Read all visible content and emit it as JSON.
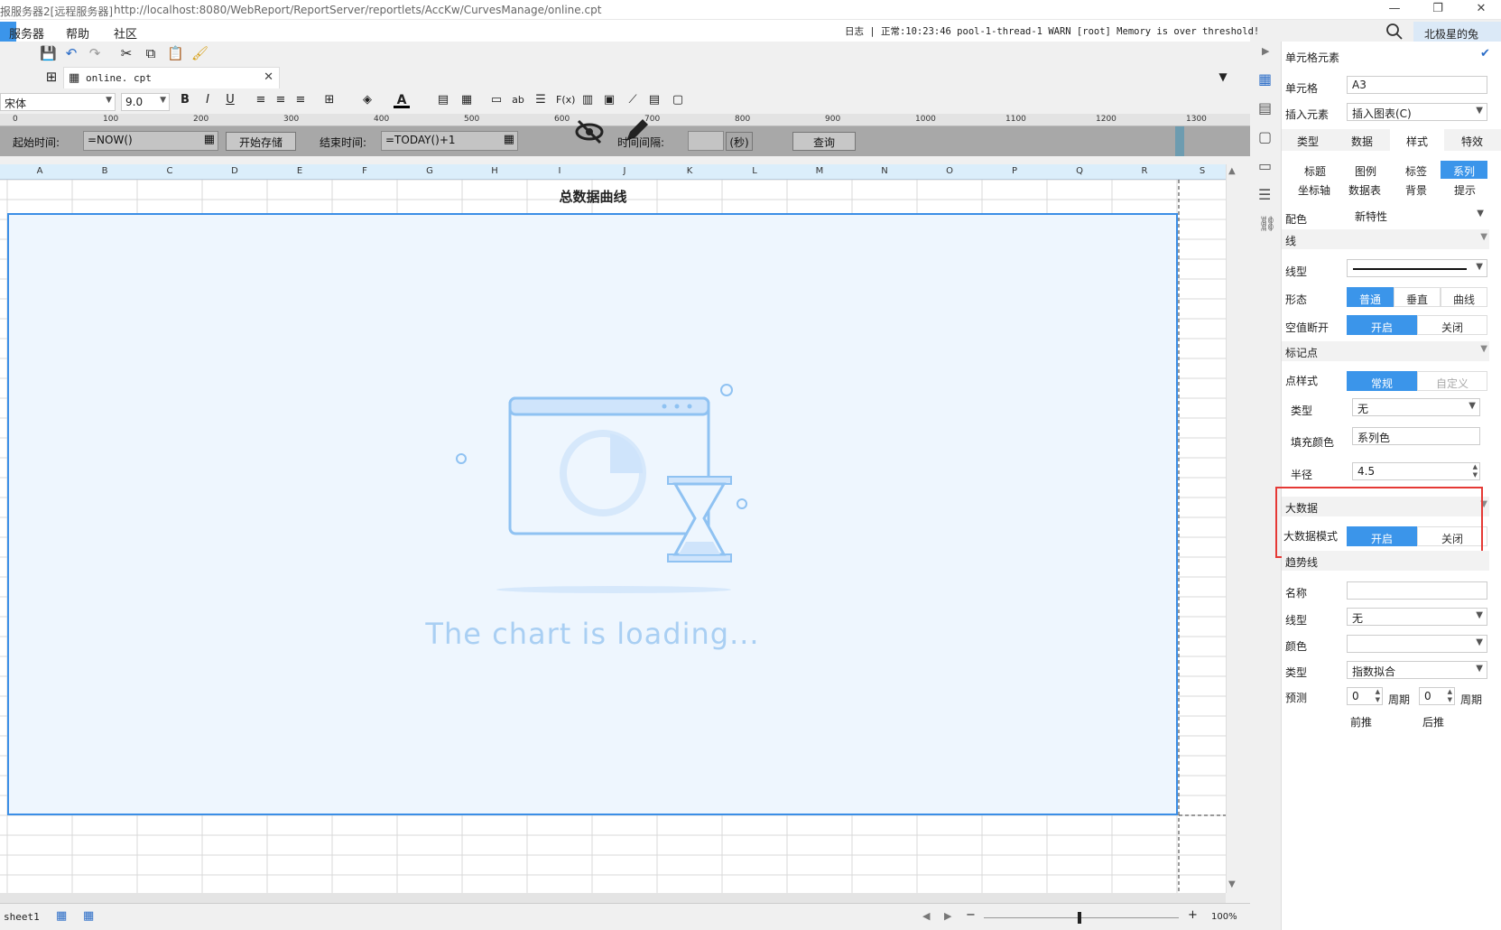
{
  "window": {
    "title_prefix": "报服务器2[远程服务器]",
    "url": "http://localhost:8080/WebReport/ReportServer/reportlets/AccKw/CurvesManage/online.cpt"
  },
  "menu": {
    "items": [
      "服务器",
      "帮助",
      "社区"
    ]
  },
  "log": {
    "text": "日志 | 正常:10:23:46 pool-1-thread-1 WARN [root] Memory is over threshold!"
  },
  "user": {
    "name": "北极星的兔"
  },
  "doc_tab": {
    "name": "online. cpt"
  },
  "format_bar": {
    "font": "宋体",
    "size": "9.0"
  },
  "ruler": {
    "ticks": [
      "0",
      "100",
      "200",
      "300",
      "400",
      "500",
      "600",
      "700",
      "800",
      "900",
      "1000",
      "1100",
      "1200",
      "1300"
    ]
  },
  "params": {
    "start_label": "起始时间:",
    "start_value": "=NOW()",
    "start_save_button": "开始存储",
    "end_label": "结束时间:",
    "end_value": "=TODAY()+1",
    "interval_label": "时间间隔:",
    "interval_unit": "(秒)",
    "query_button": "查询"
  },
  "columns": [
    "A",
    "B",
    "C",
    "D",
    "E",
    "F",
    "G",
    "H",
    "I",
    "J",
    "K",
    "L",
    "M",
    "N",
    "O",
    "P",
    "Q",
    "R",
    "S"
  ],
  "chart": {
    "title": "总数据曲线",
    "loading_text": "The chart is loading..."
  },
  "panel": {
    "header": "单元格元素",
    "cell_label": "单元格",
    "cell_value": "A3",
    "insert_label": "插入元素",
    "insert_value": "插入图表(C)",
    "tabs": [
      "类型",
      "数据",
      "样式",
      "特效"
    ],
    "subtabs_row1": [
      "标题",
      "图例",
      "标签",
      "系列"
    ],
    "subtabs_row2": [
      "坐标轴",
      "数据表",
      "背景",
      "提示"
    ],
    "color_label": "配色",
    "color_value": "新特性",
    "line_section": "线",
    "linetype_label": "线型",
    "shape_label": "形态",
    "shape_options": [
      "普通",
      "垂直",
      "曲线"
    ],
    "null_break_label": "空值断开",
    "on_off": [
      "开启",
      "关闭"
    ],
    "marker_section": "标记点",
    "point_style_label": "点样式",
    "point_style_options": [
      "常规",
      "自定义"
    ],
    "type_label": "类型",
    "type_value": "无",
    "fill_label": "填充颜色",
    "fill_value": "系列色",
    "radius_label": "半径",
    "radius_value": "4.5",
    "bigdata_section": "大数据",
    "bigdata_mode_label": "大数据模式",
    "trend_section": "趋势线",
    "name_label": "名称",
    "trend_linetype_label": "线型",
    "trend_linetype_value": "无",
    "trend_color_label": "颜色",
    "trend_type_label": "类型",
    "trend_type_value": "指数拟合",
    "predict_label": "预测",
    "predict_forward_value": "0",
    "predict_back_value": "0",
    "period_label": "周期",
    "forward_label": "前推",
    "back_label": "后推"
  },
  "bottom": {
    "sheet": "sheet1",
    "zoom": "100%"
  }
}
